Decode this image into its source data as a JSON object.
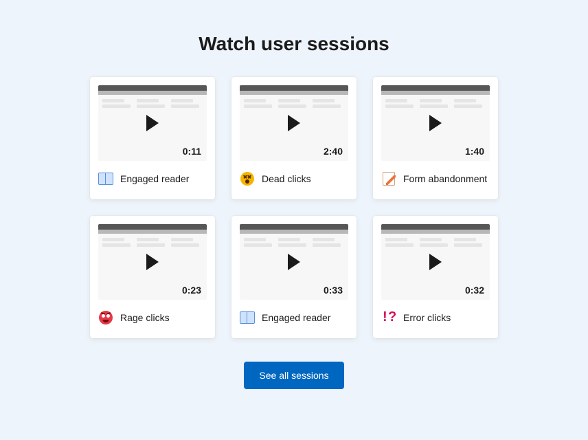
{
  "title": "Watch user sessions",
  "sessions": [
    {
      "duration": "0:11",
      "tag": "Engaged reader",
      "icon": "book-icon"
    },
    {
      "duration": "2:40",
      "tag": "Dead clicks",
      "icon": "dead-face-icon"
    },
    {
      "duration": "1:40",
      "tag": "Form abandonment",
      "icon": "form-icon"
    },
    {
      "duration": "0:23",
      "tag": "Rage clicks",
      "icon": "rage-face-icon"
    },
    {
      "duration": "0:33",
      "tag": "Engaged reader",
      "icon": "book-icon"
    },
    {
      "duration": "0:32",
      "tag": "Error clicks",
      "icon": "error-icon"
    }
  ],
  "button": {
    "see_all": "See all sessions"
  }
}
